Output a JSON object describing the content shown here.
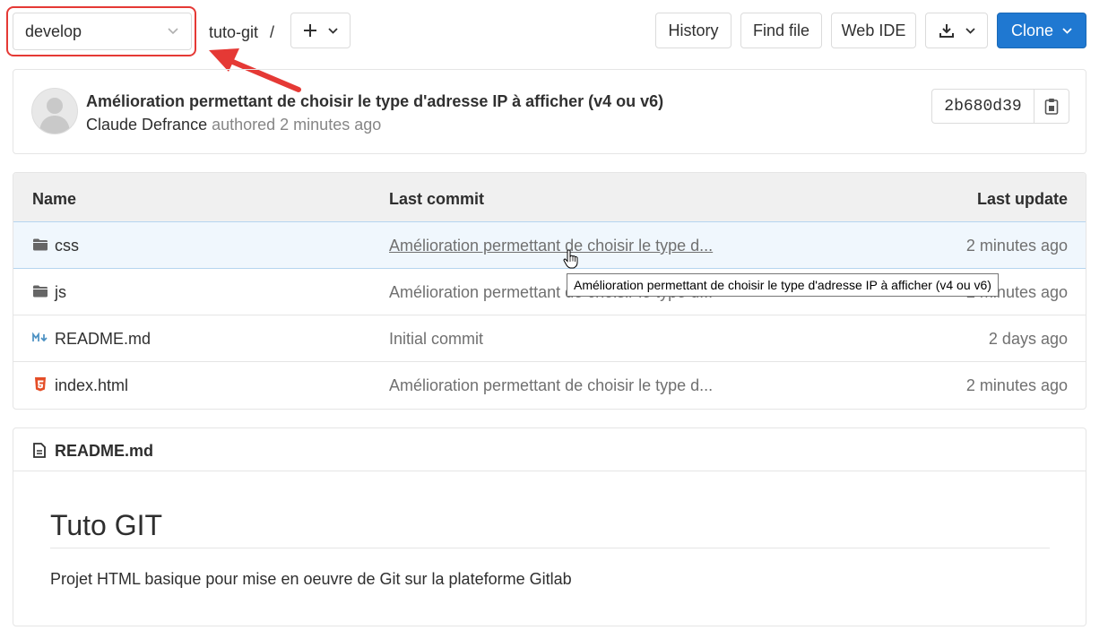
{
  "toolbar": {
    "branch": "develop",
    "project": "tuto-git",
    "separator": "/",
    "history": "History",
    "find_file": "Find file",
    "web_ide": "Web IDE",
    "clone": "Clone"
  },
  "commit": {
    "title": "Amélioration permettant de choisir le type d'adresse IP à afficher (v4 ou v6)",
    "author": "Claude Defrance",
    "meta": "authored 2 minutes ago",
    "sha": "2b680d39"
  },
  "table": {
    "headers": {
      "name": "Name",
      "last_commit": "Last commit",
      "last_update": "Last update"
    },
    "rows": [
      {
        "name": "css",
        "icon": "folder-icon",
        "message": "Amélioration permettant de choisir le type d...",
        "updated": "2 minutes ago"
      },
      {
        "name": "js",
        "icon": "folder-icon",
        "message": "Amélioration permettant de choisir le type d...",
        "updated": "2 minutes ago"
      },
      {
        "name": "README.md",
        "icon": "markdown-icon",
        "message": "Initial commit",
        "updated": "2 days ago"
      },
      {
        "name": "index.html",
        "icon": "html5-icon",
        "message": "Amélioration permettant de choisir le type d...",
        "updated": "2 minutes ago"
      }
    ]
  },
  "tooltip": "Amélioration permettant de choisir le type d'adresse IP à afficher (v4 ou v6)",
  "readme": {
    "filename": "README.md",
    "heading": "Tuto GIT",
    "paragraph": "Projet HTML basique pour mise en oeuvre de Git sur la plateforme Gitlab"
  },
  "colors": {
    "accent": "#1f78d1",
    "annotation": "#e53935"
  }
}
